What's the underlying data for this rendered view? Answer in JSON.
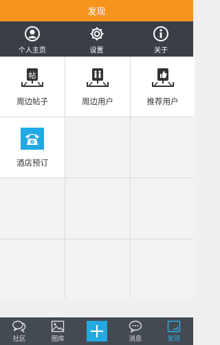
{
  "header": {
    "title": "发现"
  },
  "top_nav": [
    {
      "label": "个人主页",
      "icon": "user-icon"
    },
    {
      "label": "设置",
      "icon": "gear-icon"
    },
    {
      "label": "关于",
      "icon": "info-icon"
    }
  ],
  "grid": [
    {
      "label": "周边帖子",
      "icon": "nearby-posts-icon"
    },
    {
      "label": "周边用户",
      "icon": "nearby-users-icon"
    },
    {
      "label": "推荐用户",
      "icon": "recommended-users-icon"
    },
    {
      "label": "酒店预订",
      "icon": "hotel-phone-icon"
    }
  ],
  "bottom_tabs": [
    {
      "label": "社区",
      "icon": "chat-bubbles-icon"
    },
    {
      "label": "图库",
      "icon": "image-icon"
    },
    {
      "label": "",
      "icon": "plus-icon"
    },
    {
      "label": "消息",
      "icon": "message-icon"
    },
    {
      "label": "发现",
      "icon": "discover-icon",
      "active": true
    }
  ],
  "colors": {
    "header": "#f7941d",
    "nav": "#3a3f47",
    "active": "#2bb1e6"
  }
}
